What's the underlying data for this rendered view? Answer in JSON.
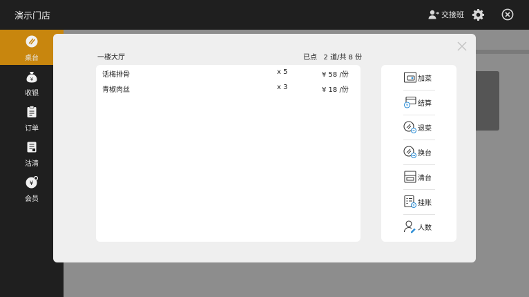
{
  "app": {
    "store_name": "演示门店"
  },
  "header": {
    "shift_label": "交接班"
  },
  "sidebar": {
    "items": [
      {
        "label": "桌台",
        "icon": "table-icon",
        "active": true
      },
      {
        "label": "收银",
        "icon": "money-bag-icon",
        "active": false
      },
      {
        "label": "订单",
        "icon": "order-icon",
        "active": false
      },
      {
        "label": "沽清",
        "icon": "sold-out-icon",
        "active": false
      },
      {
        "label": "会员",
        "icon": "member-icon",
        "active": false
      }
    ]
  },
  "modal": {
    "area_name": "一楼大厅",
    "ordered_summary": "已点   2 道/共 8 份",
    "dishes": [
      {
        "name": "话梅排骨",
        "qty": "x 5",
        "price": "¥ 58 /份"
      },
      {
        "name": "青椒肉丝",
        "qty": "x 3",
        "price": "¥ 18 /份"
      }
    ],
    "actions": [
      {
        "label": "加菜",
        "icon": "add-dish-icon"
      },
      {
        "label": "结算",
        "icon": "checkout-icon"
      },
      {
        "label": "退菜",
        "icon": "return-dish-icon"
      },
      {
        "label": "换台",
        "icon": "change-table-icon"
      },
      {
        "label": "清台",
        "icon": "clear-table-icon"
      },
      {
        "label": "挂账",
        "icon": "credit-icon"
      },
      {
        "label": "人数",
        "icon": "guest-count-icon"
      }
    ]
  },
  "colors": {
    "accent": "#c8860e",
    "sidebar_bg": "#1f1f1f",
    "icon_blue": "#2f8fd6"
  }
}
